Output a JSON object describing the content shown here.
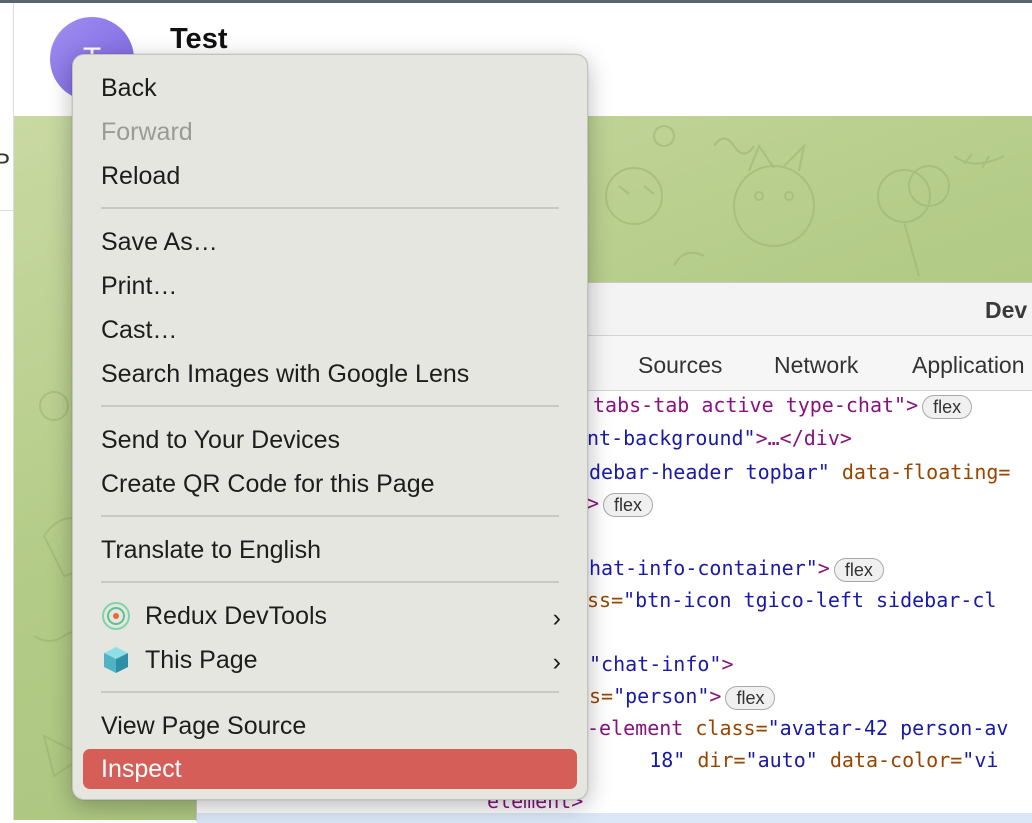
{
  "chat": {
    "avatar_letter": "T",
    "name": "Test",
    "left_partial": "P"
  },
  "devtools": {
    "title": "Dev",
    "tabs": [
      "e",
      "Sources",
      "Network",
      "Application"
    ],
    "code": [
      {
        "parts": [
          [
            "tag",
            "tabs-tab active type-chat\">"
          ]
        ],
        "badge": "flex"
      },
      {
        "parts": [
          [
            "val",
            "nt-background\""
          ],
          [
            "tag",
            ">…</div>"
          ]
        ],
        "badge": ""
      },
      {
        "parts": [
          [
            "val",
            "debar-header topbar\" "
          ],
          [
            "attr",
            "data-floating="
          ]
        ],
        "badge": ""
      },
      {
        "parts": [
          [
            "tag",
            ">"
          ]
        ],
        "badge": "flex"
      },
      {
        "parts": [],
        "badge": ""
      },
      {
        "parts": [
          [
            "val",
            "hat-info-container\""
          ],
          [
            "tag",
            ">"
          ]
        ],
        "badge": "flex"
      },
      {
        "parts": [
          [
            "attr",
            "ss="
          ],
          [
            "val",
            "\"btn-icon tgico-left sidebar-cl"
          ]
        ],
        "badge": ""
      },
      {
        "parts": [],
        "badge": ""
      },
      {
        "parts": [
          [
            "val",
            "\"chat-info\""
          ],
          [
            "tag",
            ">"
          ]
        ],
        "badge": ""
      },
      {
        "parts": [
          [
            "attr",
            "s="
          ],
          [
            "val",
            "\"person\""
          ],
          [
            "tag",
            ">"
          ]
        ],
        "badge": "flex"
      },
      {
        "parts": [
          [
            "tag",
            "-element "
          ],
          [
            "attr",
            "class="
          ],
          [
            "val",
            "\"avatar-42 person-av"
          ]
        ],
        "badge": ""
      },
      {
        "parts": [
          [
            "val",
            "     18\" "
          ],
          [
            "attr",
            "dir="
          ],
          [
            "val",
            "\"auto\" "
          ],
          [
            "attr",
            "data-color="
          ],
          [
            "val",
            "\"vi"
          ]
        ],
        "badge": ""
      },
      {
        "parts": [
          [
            "tag",
            "element>"
          ]
        ],
        "badge": ""
      }
    ]
  },
  "menu": {
    "items": [
      {
        "label": "Back",
        "enabled": true
      },
      {
        "label": "Forward",
        "enabled": false
      },
      {
        "label": "Reload",
        "enabled": true
      },
      {
        "label": "Save As…",
        "enabled": true
      },
      {
        "label": "Print…",
        "enabled": true
      },
      {
        "label": "Cast…",
        "enabled": true
      },
      {
        "label": "Search Images with Google Lens",
        "enabled": true
      },
      {
        "label": "Send to Your Devices",
        "enabled": true
      },
      {
        "label": "Create QR Code for this Page",
        "enabled": true
      },
      {
        "label": "Translate to English",
        "enabled": true
      },
      {
        "label": "Redux DevTools",
        "enabled": true,
        "icon": "redux-devtools-icon",
        "submenu": true
      },
      {
        "label": "This Page",
        "enabled": true,
        "icon": "cube-icon",
        "submenu": true
      },
      {
        "label": "View Page Source",
        "enabled": true
      },
      {
        "label": "Inspect",
        "enabled": true,
        "highlighted": true
      }
    ],
    "submenu_glyph": "›",
    "highlight_color": "#d55e58"
  }
}
